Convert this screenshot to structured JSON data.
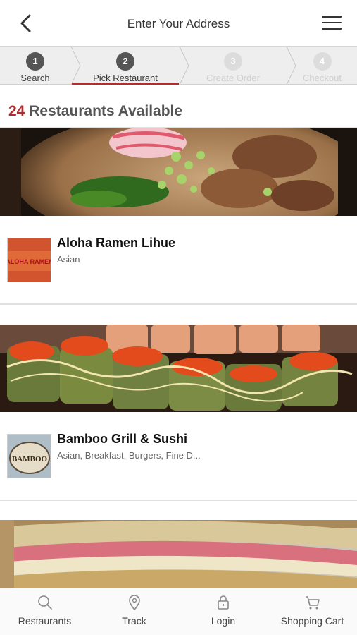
{
  "header": {
    "title": "Enter Your Address",
    "back_icon": "chevron-left-icon",
    "menu_icon": "hamburger-menu-icon"
  },
  "steps": [
    {
      "num": "1",
      "label": "Search",
      "state": "done"
    },
    {
      "num": "2",
      "label": "Pick Restaurant",
      "state": "active"
    },
    {
      "num": "3",
      "label": "Create Order",
      "state": "todo"
    },
    {
      "num": "4",
      "label": "Checkout",
      "state": "todo"
    }
  ],
  "results": {
    "count": "24",
    "label": "Restaurants Available"
  },
  "restaurants": [
    {
      "name": "Aloha Ramen Lihue",
      "categories": "Asian",
      "logo_text": "ALOHA RAMEN"
    },
    {
      "name": "Bamboo Grill & Sushi",
      "categories": "Asian, Breakfast, Burgers, Fine D...",
      "logo_text": "BAMBOO"
    }
  ],
  "bottom_nav": [
    {
      "label": "Restaurants",
      "icon": "search-icon"
    },
    {
      "label": "Track",
      "icon": "map-pin-icon"
    },
    {
      "label": "Login",
      "icon": "lock-icon"
    },
    {
      "label": "Shopping Cart",
      "icon": "cart-icon"
    }
  ],
  "colors": {
    "accent": "#c0272d",
    "count_red": "#b22a2e",
    "step_done": "#555555",
    "step_todo": "#dcdcdc"
  }
}
